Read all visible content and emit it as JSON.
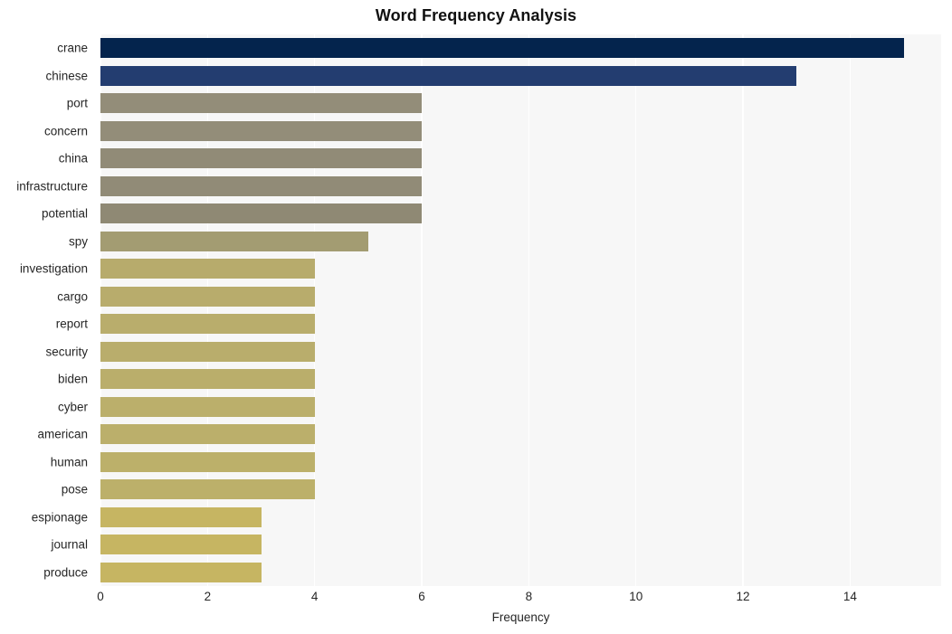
{
  "chart_data": {
    "type": "bar",
    "orientation": "horizontal",
    "title": "Word Frequency Analysis",
    "xlabel": "Frequency",
    "ylabel": "",
    "xlim": [
      0,
      15.7
    ],
    "xticks": [
      0,
      2,
      4,
      6,
      8,
      10,
      12,
      14
    ],
    "xtick_labels": [
      "0",
      "2",
      "4",
      "6",
      "8",
      "10",
      "12",
      "14"
    ],
    "grid": "vertical-only",
    "legend": "none",
    "categories": [
      "crane",
      "chinese",
      "port",
      "concern",
      "china",
      "infrastructure",
      "potential",
      "spy",
      "investigation",
      "cargo",
      "report",
      "security",
      "biden",
      "cyber",
      "american",
      "human",
      "pose",
      "espionage",
      "journal",
      "produce"
    ],
    "values": [
      15,
      13,
      6,
      6,
      6,
      6,
      6,
      5,
      4,
      4,
      4,
      4,
      4,
      4,
      4,
      4,
      4,
      3,
      3,
      3
    ],
    "bar_colors": [
      "#04244d",
      "#233d70",
      "#938d79",
      "#938d79",
      "#918b77",
      "#918b77",
      "#8f8974",
      "#a39c72",
      "#b7ab6c",
      "#b8ac6c",
      "#b9ad6c",
      "#b9ad6c",
      "#baae6b",
      "#bbaf6b",
      "#bbaf6b",
      "#bcb06a",
      "#bcb06a",
      "#c6b562",
      "#c6b562",
      "#c6b562"
    ]
  },
  "style": {
    "plot_background": "#f7f7f7",
    "figure_background": "#ffffff",
    "gridline_color": "#ffffff",
    "text_color": "#262626",
    "title_color": "#111111"
  }
}
